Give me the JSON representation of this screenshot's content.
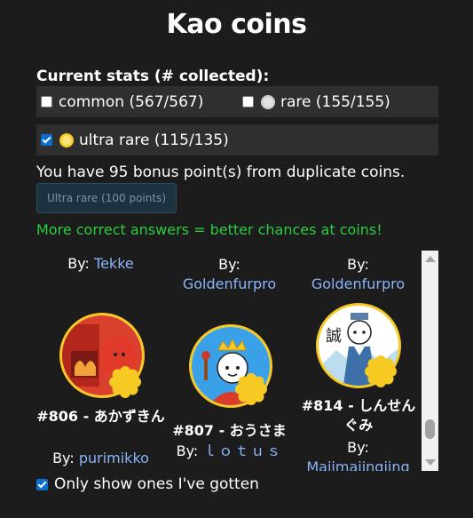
{
  "page": {
    "title": "Kao coins"
  },
  "stats": {
    "heading": "Current stats (# collected):",
    "common": {
      "label": "common (567/567)",
      "checked": false
    },
    "rare": {
      "label": "rare (155/155)",
      "checked": false,
      "coin_icon": "silver-coin-icon",
      "coin_color": "#cfcfcf"
    },
    "ultra_rare": {
      "label": "ultra rare (115/135)",
      "checked": true,
      "coin_icon": "gold-coin-icon",
      "coin_color": "#f7c923"
    }
  },
  "bonus": {
    "text": "You have 95 bonus point(s) from duplicate coins.",
    "button_label": "Ultra rare (100 points)"
  },
  "hint": "More correct answers = better chances at coins!",
  "coins": [
    {
      "top_by_label": "By:",
      "top_author": "Tekke",
      "number_name": "#806 - あかずきん",
      "by_label": "By:",
      "author": "purimikko",
      "badge": "gold-coin-icon"
    },
    {
      "top_by_label": "By:",
      "top_author": "Goldenfurpro",
      "number_name": "#807 - おうさま",
      "by_label": "By:",
      "author": "ｌｏｔｕｓ",
      "badge": "gold-coin-icon"
    },
    {
      "top_by_label": "By:",
      "top_author": "Goldenfurpro",
      "number_name": "#814 - しんせんぐみ",
      "by_label": "By:",
      "author": "Majimajingiing",
      "badge": "gold-coin-icon"
    }
  ],
  "filter": {
    "only_show_label": "Only show ones I've gotten",
    "checked": true
  },
  "colors": {
    "background": "#1c1c1c",
    "link": "#8ab4f8",
    "hint": "#2ecc40",
    "gold": "#f7c923"
  }
}
